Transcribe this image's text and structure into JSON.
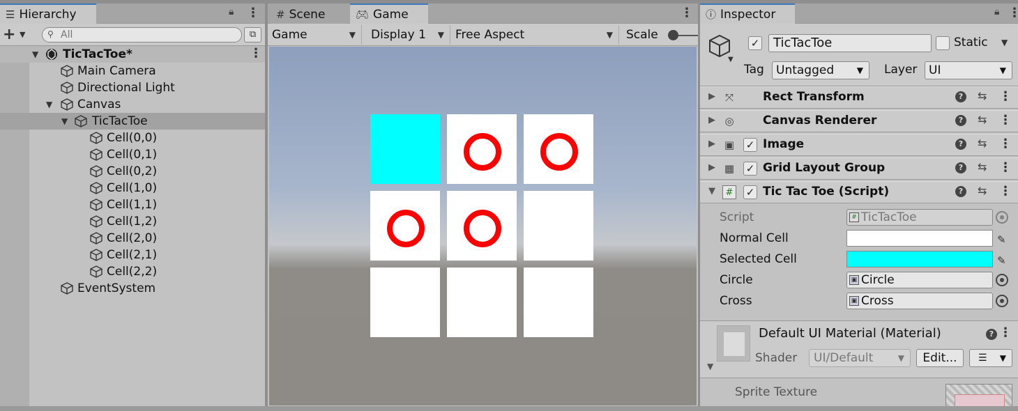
{
  "hierarchy": {
    "tab_label": "Hierarchy",
    "search_placeholder": "All",
    "items": [
      {
        "label": "TicTacToe*"
      },
      {
        "label": "Main Camera"
      },
      {
        "label": "Directional Light"
      },
      {
        "label": "Canvas"
      },
      {
        "label": "TicTacToe"
      },
      {
        "label": "Cell(0,0)"
      },
      {
        "label": "Cell(0,1)"
      },
      {
        "label": "Cell(0,2)"
      },
      {
        "label": "Cell(1,0)"
      },
      {
        "label": "Cell(1,1)"
      },
      {
        "label": "Cell(1,2)"
      },
      {
        "label": "Cell(2,0)"
      },
      {
        "label": "Cell(2,1)"
      },
      {
        "label": "Cell(2,2)"
      },
      {
        "label": "EventSystem"
      }
    ]
  },
  "game": {
    "tabs": [
      {
        "label": "Scene"
      },
      {
        "label": "Game"
      }
    ],
    "active_tab": "Game",
    "toolbar": {
      "view_select": "Game",
      "display_select": "Display 1",
      "aspect_select": "Free Aspect",
      "scale_label": "Scale"
    },
    "board": {
      "cells": [
        {
          "row": 0,
          "col": 0,
          "mark": "",
          "selected": true
        },
        {
          "row": 0,
          "col": 1,
          "mark": "circle",
          "selected": false
        },
        {
          "row": 0,
          "col": 2,
          "mark": "circle",
          "selected": false
        },
        {
          "row": 1,
          "col": 0,
          "mark": "circle",
          "selected": false
        },
        {
          "row": 1,
          "col": 1,
          "mark": "circle",
          "selected": false
        },
        {
          "row": 1,
          "col": 2,
          "mark": "",
          "selected": false
        },
        {
          "row": 2,
          "col": 0,
          "mark": "",
          "selected": false
        },
        {
          "row": 2,
          "col": 1,
          "mark": "",
          "selected": false
        },
        {
          "row": 2,
          "col": 2,
          "mark": "",
          "selected": false
        }
      ],
      "normal_color": "#ffffff",
      "selected_color": "#00ffff",
      "circle_color": "#ff0000"
    }
  },
  "inspector": {
    "tab_label": "Inspector",
    "object_name": "TicTacToe",
    "static_label": "Static",
    "tag_label": "Tag",
    "tag_value": "Untagged",
    "layer_label": "Layer",
    "layer_value": "UI",
    "components": [
      {
        "title": "Rect Transform",
        "icon": "rect-transform-icon"
      },
      {
        "title": "Canvas Renderer",
        "icon": "canvas-renderer-icon"
      },
      {
        "title": "Image",
        "icon": "image-icon"
      },
      {
        "title": "Grid Layout Group",
        "icon": "grid-layout-icon"
      },
      {
        "title": "Tic Tac Toe (Script)",
        "icon": "script-icon"
      }
    ],
    "script_fields": {
      "script_label": "Script",
      "script_value": "TicTacToe",
      "normal_cell_label": "Normal Cell",
      "normal_cell_color": "#ffffff",
      "selected_cell_label": "Selected Cell",
      "selected_cell_color": "#00ffff",
      "circle_label": "Circle",
      "circle_value": "Circle",
      "cross_label": "Cross",
      "cross_value": "Cross"
    },
    "material": {
      "title": "Default UI Material (Material)",
      "shader_label": "Shader",
      "shader_value": "UI/Default",
      "edit_label": "Edit...",
      "sprite_texture_label": "Sprite Texture"
    }
  }
}
